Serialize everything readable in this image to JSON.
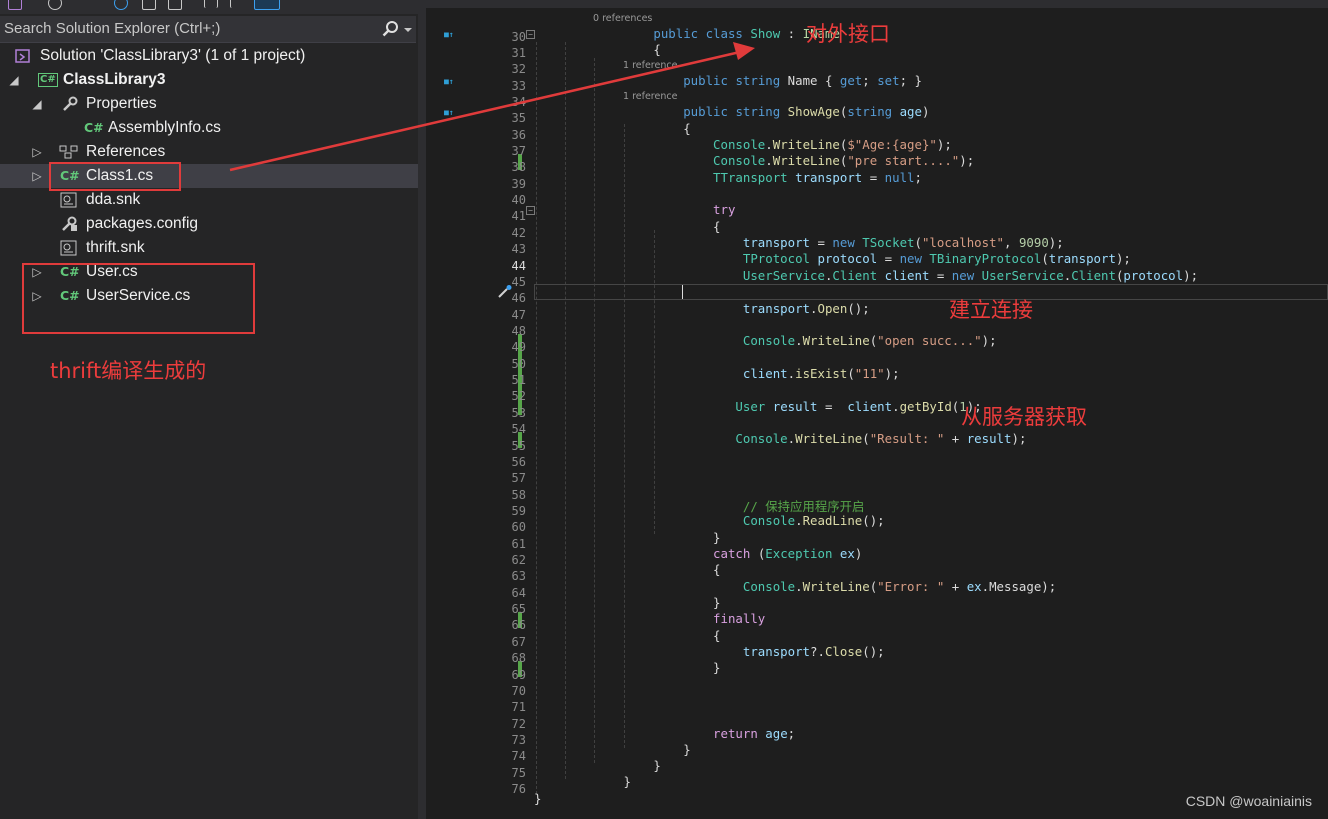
{
  "solution_explorer": {
    "search_placeholder": "Search Solution Explorer (Ctrl+;)",
    "solution": "Solution 'ClassLibrary3' (1 of 1 project)",
    "project": "ClassLibrary3",
    "properties": "Properties",
    "assembly_info": "AssemblyInfo.cs",
    "references": "References",
    "class1": "Class1.cs",
    "dda_snk": "dda.snk",
    "packages_config": "packages.config",
    "thrift_snk": "thrift.snk",
    "user_cs": "User.cs",
    "user_service_cs": "UserService.cs"
  },
  "annotations": {
    "interface": "对外接口",
    "connect": "建立连接",
    "fetch": "从服务器获取",
    "thrift_generated": "thrift编译生成的"
  },
  "editor": {
    "code_lens": {
      "class": "0 references",
      "property": "1 reference",
      "method": "1 reference"
    },
    "line_numbers": [
      "30",
      "31",
      "32",
      "33",
      "34",
      "35",
      "36",
      "37",
      "38",
      "39",
      "40",
      "41",
      "42",
      "43",
      "44",
      "45",
      "46",
      "47",
      "48",
      "49",
      "50",
      "51",
      "52",
      "53",
      "54",
      "55",
      "56",
      "57",
      "58",
      "59",
      "60",
      "61",
      "62",
      "63",
      "64",
      "65",
      "66",
      "67",
      "68",
      "69",
      "70",
      "71",
      "72",
      "73",
      "74",
      "75",
      "76"
    ],
    "comment": "// 保持应用程序开启",
    "strings": {
      "age_fmt": "$\"Age:{age}\"",
      "pre_start": "\"pre start....\"",
      "localhost": "\"localhost\"",
      "open_succ": "\"open succ...\"",
      "eleven": "\"11\"",
      "result": "\"Result: \"",
      "error": "\"Error: \""
    },
    "numbers": {
      "port": "9090",
      "id": "1"
    }
  },
  "watermark": "CSDN @woainiainis",
  "colors": {
    "annotation_red": "#e03b3b",
    "change_bar": "#57a64a",
    "csharp_icon": "#62c87a"
  }
}
